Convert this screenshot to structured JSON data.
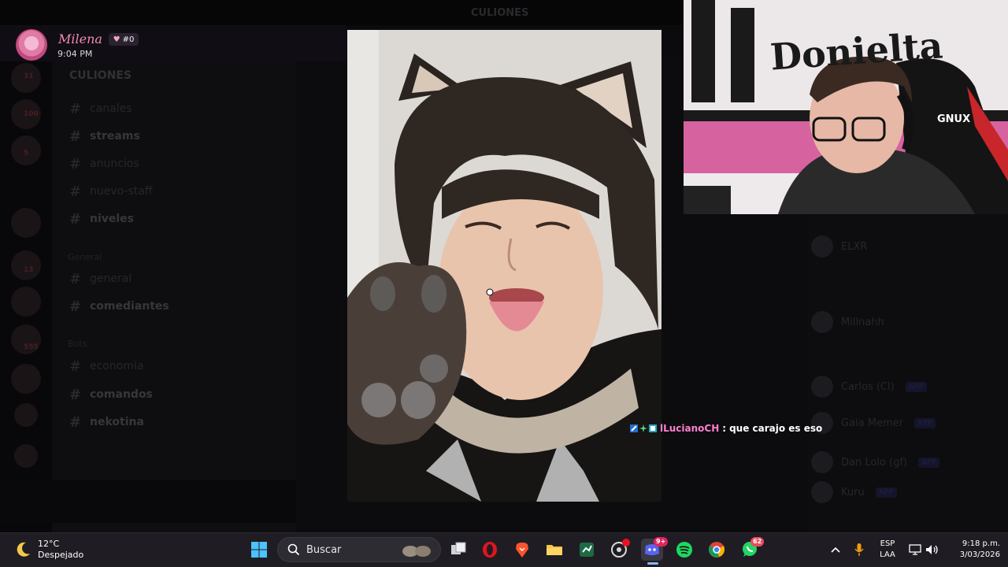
{
  "discord": {
    "server_name": "CULIONES",
    "header_title": "CULIONES",
    "channels": [
      {
        "name": "canales"
      },
      {
        "name": "streams"
      },
      {
        "name": "anuncios"
      },
      {
        "name": "nuevo-staff"
      },
      {
        "name": "niveles"
      },
      {
        "name": "general"
      },
      {
        "name": "comediantes"
      },
      {
        "name": "economia"
      },
      {
        "name": "comandos"
      },
      {
        "name": "nekotina"
      }
    ],
    "categories": [
      "General",
      "Bots"
    ],
    "guild_badges": [
      "31",
      "100",
      "5",
      "13",
      "555"
    ],
    "members": [
      {
        "name": "ELXR",
        "tag": ""
      },
      {
        "name": "Millnahh",
        "tag": ""
      },
      {
        "name": "Carlos (Cl)",
        "tag": "APP"
      },
      {
        "name": "Gaia Memer",
        "tag": "APP"
      },
      {
        "name": "Dan Lolo (gf)",
        "tag": "APP"
      },
      {
        "name": "Kuru",
        "tag": "APP"
      }
    ]
  },
  "notification": {
    "user": "Milena",
    "emoji_text": "#0",
    "time": "9:04 PM"
  },
  "webcam": {
    "graffiti_text": "Donielta",
    "chair_text": "GNUX"
  },
  "chat_message": {
    "user": "lLucianoCH",
    "separator": ":",
    "text": "que carajo es eso"
  },
  "taskbar": {
    "weather_temp": "12°C",
    "weather_condition": "Despejado",
    "search_placeholder": "Buscar",
    "discord_badge": "9+",
    "whatsapp_badge": "62",
    "lang_1": "ESP",
    "lang_2": "LAA",
    "time": "9:18 p.m.",
    "date": "3/03/2026"
  },
  "colors": {
    "taskbar_bg": "#1f1d23",
    "chat_username": "#ff7fd0",
    "notification_name": "#f28bb0"
  }
}
